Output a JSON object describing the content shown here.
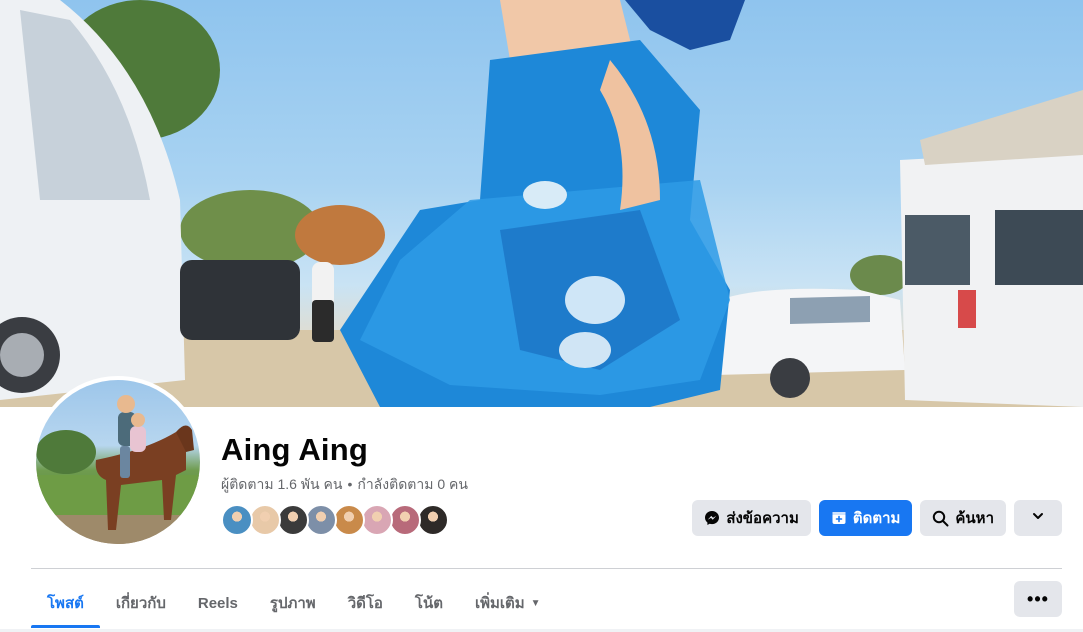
{
  "profile": {
    "name": "Aing Aing",
    "followers_text": "ผู้ติดตาม 1.6 พัน คน",
    "following_text": "กำลังติดตาม 0 คน",
    "separator": "•"
  },
  "friends": [
    {
      "name": "friend-1",
      "color": "#4a8fc2"
    },
    {
      "name": "friend-2",
      "color": "#e8c9a8"
    },
    {
      "name": "friend-3",
      "color": "#3b3b3b"
    },
    {
      "name": "friend-4",
      "color": "#7d8fa8"
    },
    {
      "name": "friend-5",
      "color": "#c98a4a"
    },
    {
      "name": "friend-6",
      "color": "#d9a6b4"
    },
    {
      "name": "friend-7",
      "color": "#b86a7a"
    },
    {
      "name": "friend-8",
      "color": "#2e2a28"
    }
  ],
  "actions": {
    "message_label": "ส่งข้อความ",
    "follow_label": "ติดตาม",
    "search_label": "ค้นหา"
  },
  "tabs": [
    {
      "label": "โพสต์",
      "active": true
    },
    {
      "label": "เกี่ยวกับ",
      "active": false
    },
    {
      "label": "Reels",
      "active": false
    },
    {
      "label": "รูปภาพ",
      "active": false
    },
    {
      "label": "วิดีโอ",
      "active": false
    },
    {
      "label": "โน้ต",
      "active": false
    },
    {
      "label": "เพิ่มเติม",
      "active": false
    }
  ],
  "more_menu_label": "•••",
  "colors": {
    "accent": "#1877f2",
    "button_gray": "#e4e6eb",
    "secondary_text": "#65676b"
  }
}
